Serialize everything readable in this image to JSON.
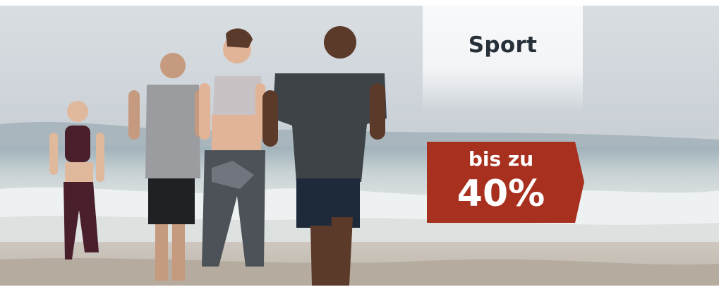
{
  "banner": {
    "category_title": "Sport",
    "promo_prefix": "bis zu",
    "promo_value": "40%",
    "colors": {
      "title_text": "#273038",
      "badge_background": "#a8301f",
      "badge_text": "#ffffff"
    }
  }
}
